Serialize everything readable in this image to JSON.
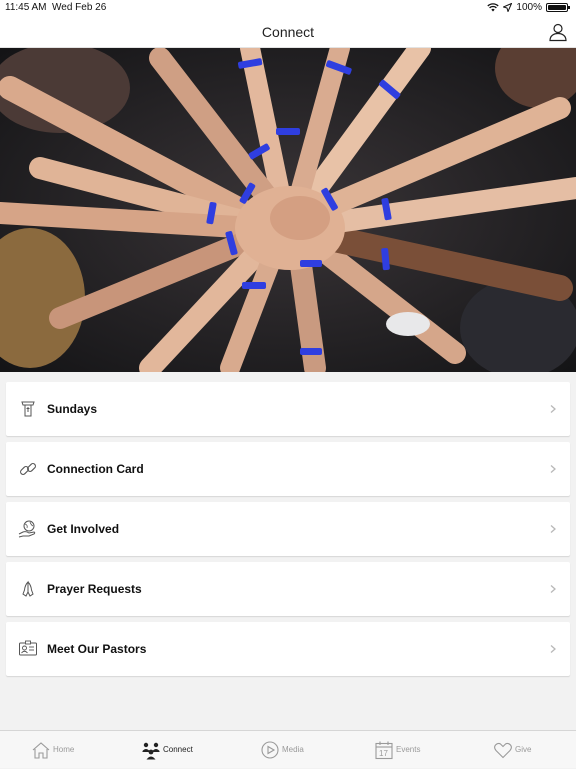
{
  "status_bar": {
    "time": "11:45 AM",
    "date": "Wed Feb 26",
    "battery": "100%",
    "battery_level": 1.0
  },
  "header": {
    "title": "Connect",
    "profile_icon": "person-icon"
  },
  "hero": {
    "icon": "hands-together-photo"
  },
  "menu": {
    "items": [
      {
        "label": "Sundays",
        "icon": "pulpit-icon"
      },
      {
        "label": "Connection Card",
        "icon": "link-icon"
      },
      {
        "label": "Get Involved",
        "icon": "globe-hand-icon"
      },
      {
        "label": "Prayer Requests",
        "icon": "praying-hands-icon"
      },
      {
        "label": "Meet Our Pastors",
        "icon": "id-card-icon"
      }
    ]
  },
  "tab_bar": {
    "tabs": [
      {
        "label": "Home",
        "icon": "house-icon"
      },
      {
        "label": "Connect",
        "icon": "people-icon",
        "active": true
      },
      {
        "label": "Media",
        "icon": "play-icon"
      },
      {
        "label": "Events",
        "icon": "calendar-icon",
        "day": "17"
      },
      {
        "label": "Give",
        "icon": "heart-icon"
      }
    ]
  },
  "colors": {
    "accent": "#222222",
    "inactive": "#9a9a9a",
    "wristband": "#2f3ee0"
  }
}
